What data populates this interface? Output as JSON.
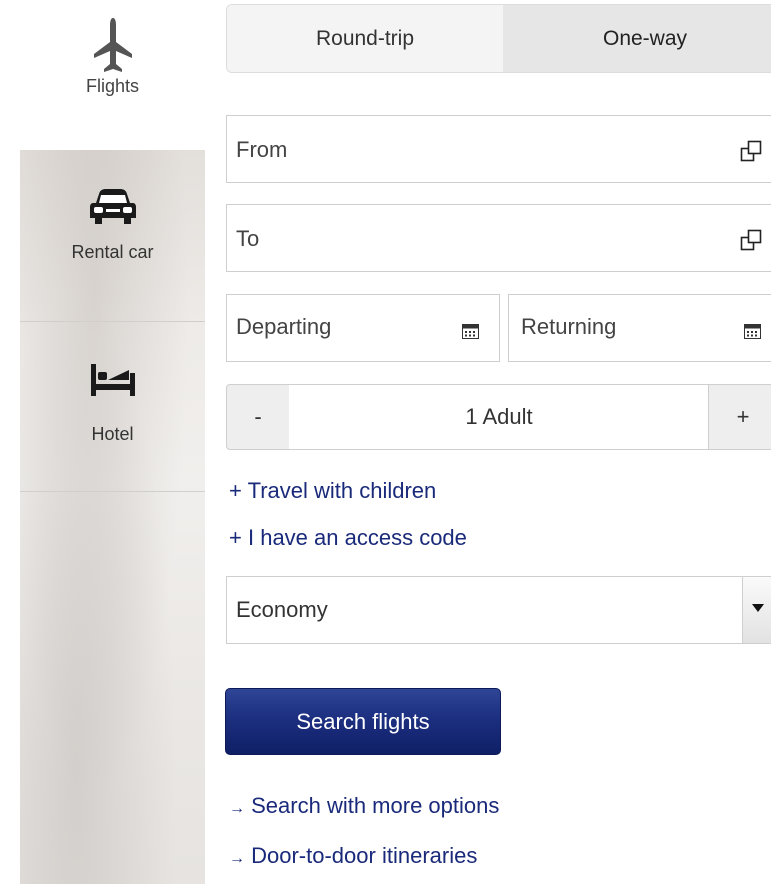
{
  "sidebar": {
    "items": [
      {
        "label": "Flights",
        "icon": "airplane-icon"
      },
      {
        "label": "Rental car",
        "icon": "car-icon"
      },
      {
        "label": "Hotel",
        "icon": "bed-icon"
      }
    ]
  },
  "trip_type": {
    "round_trip": "Round-trip",
    "one_way": "One-way",
    "selected": "One-way"
  },
  "form": {
    "from_placeholder": "From",
    "to_placeholder": "To",
    "departing_placeholder": "Departing",
    "returning_placeholder": "Returning",
    "passengers": {
      "minus": "-",
      "value": "1 Adult",
      "plus": "+"
    },
    "travel_with_children": {
      "sign": "+",
      "label": "Travel with children"
    },
    "access_code": {
      "sign": "+",
      "label": "I have an access code"
    },
    "cabin_class": "Economy",
    "search_button": "Search flights"
  },
  "links": {
    "more_options": {
      "arrow": "→",
      "label": "Search with more options"
    },
    "door_to_door": {
      "arrow": "→",
      "label": "Door-to-door itineraries"
    }
  },
  "colors": {
    "primary_button": "#1c2f80",
    "link": "#1a2a7a"
  }
}
